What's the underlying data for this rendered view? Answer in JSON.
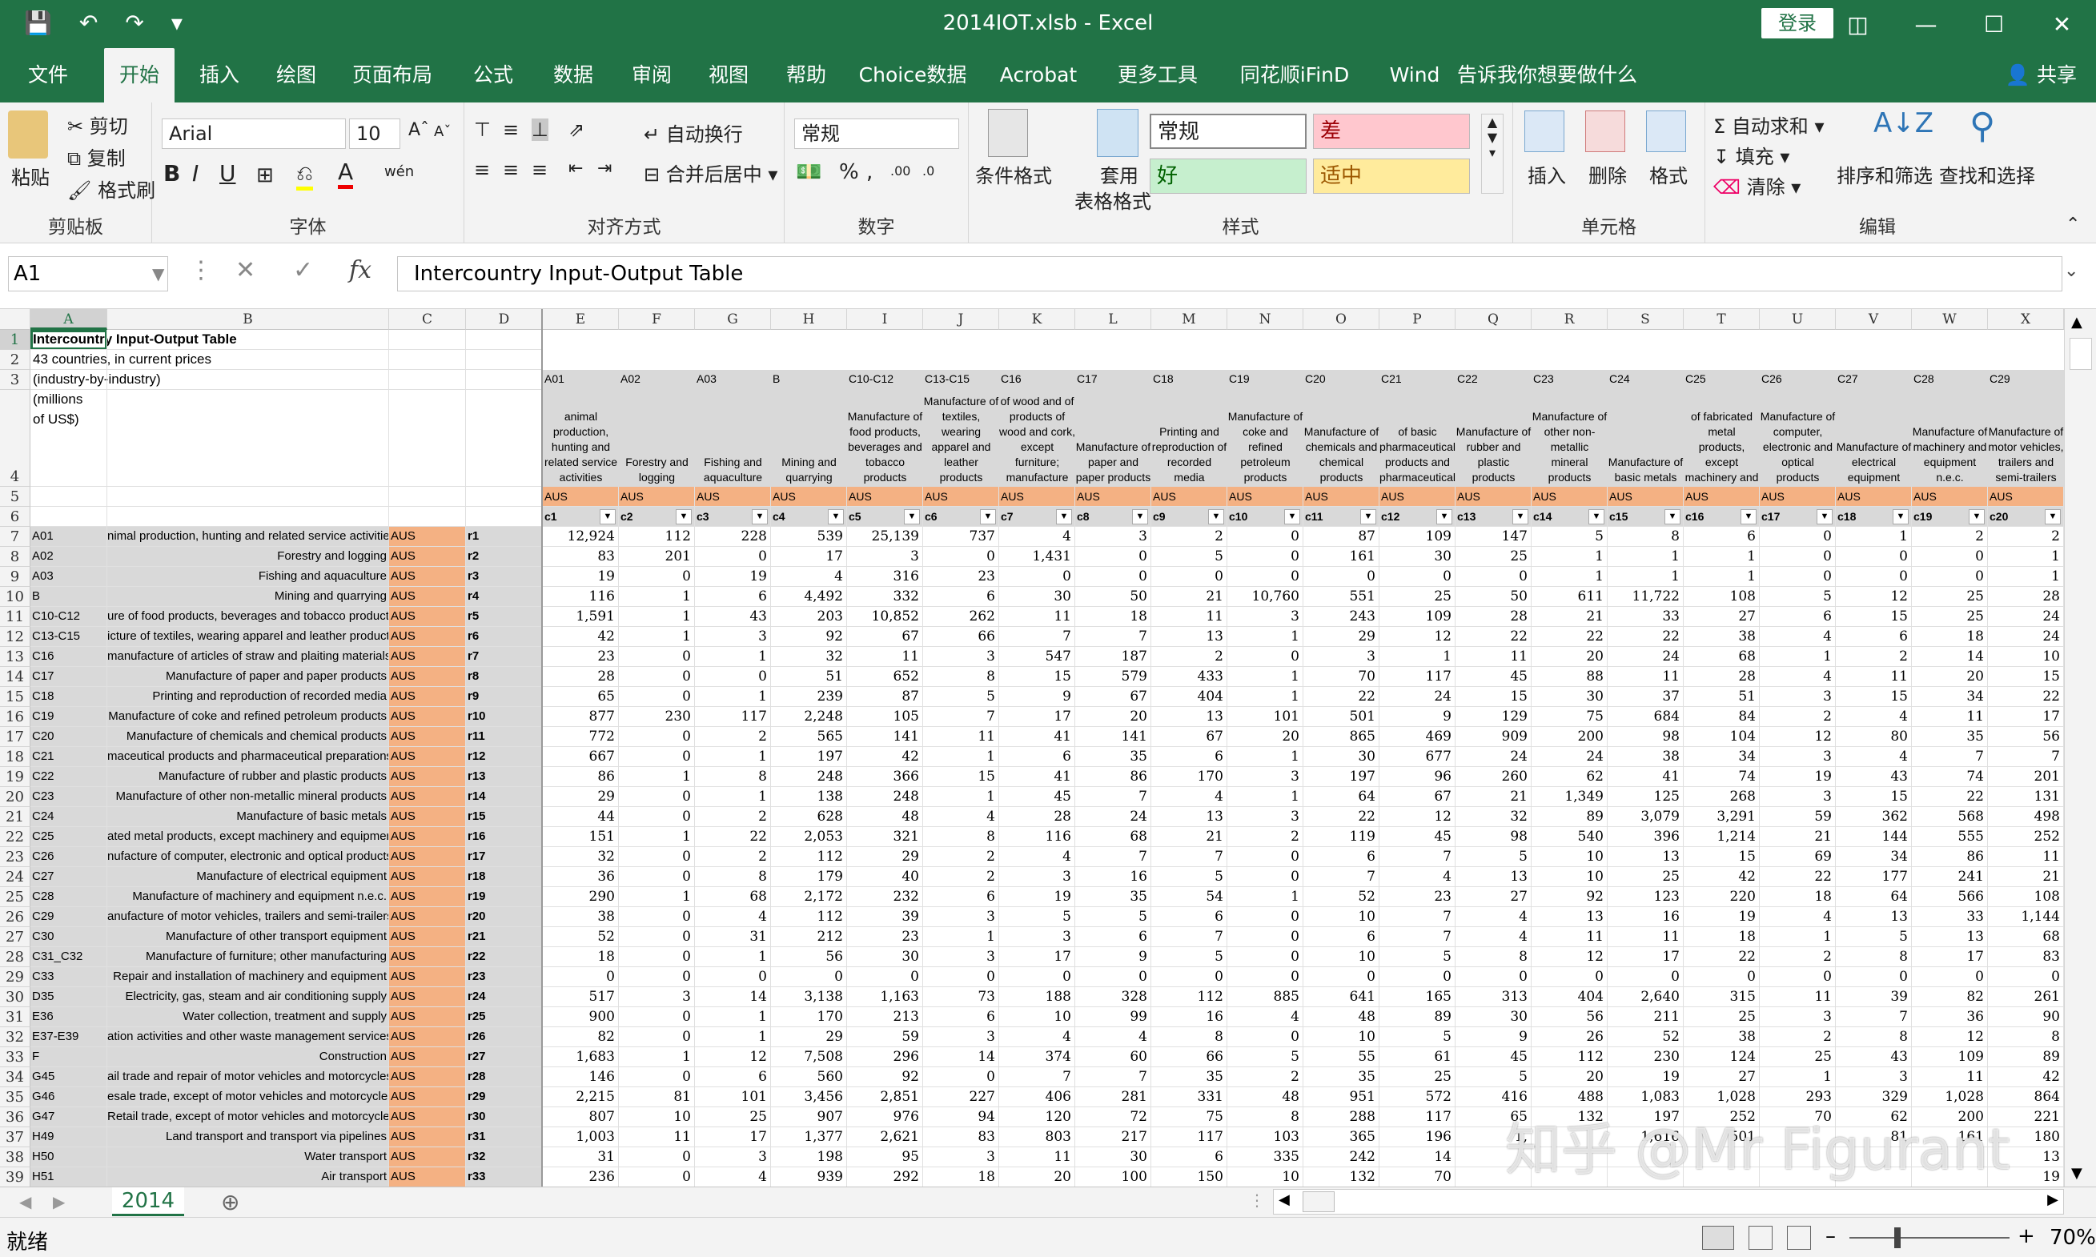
{
  "window": {
    "title": "2014IOT.xlsb  -  Excel",
    "login": "登录",
    "share": "共享"
  },
  "tabs": [
    "文件",
    "开始",
    "插入",
    "绘图",
    "页面布局",
    "公式",
    "数据",
    "审阅",
    "视图",
    "帮助",
    "Choice数据",
    "Acrobat",
    "更多工具",
    "同花顺iFinD",
    "Wind",
    "告诉我你想要做什么"
  ],
  "ribbon": {
    "clipboard": {
      "paste": "粘贴",
      "cut": "剪切",
      "copy": "复制",
      "format_painter": "格式刷",
      "label": "剪贴板"
    },
    "font": {
      "name": "Arial",
      "size": "10",
      "label": "字体"
    },
    "align": {
      "wrap": "自动换行",
      "merge": "合并后居中",
      "label": "对齐方式"
    },
    "number": {
      "format": "常规",
      "label": "数字"
    },
    "styles": {
      "cond": "条件格式",
      "table": "套用",
      "table2": "表格格式",
      "normal": "常规",
      "bad": "差",
      "good": "好",
      "neutral": "适中",
      "label": "样式"
    },
    "cells": {
      "insert": "插入",
      "delete": "删除",
      "format": "格式",
      "label": "单元格"
    },
    "edit": {
      "autosum": "自动求和",
      "fill": "填充",
      "clear": "清除",
      "sort": "排序和筛选",
      "find": "查找和选择",
      "label": "编辑"
    }
  },
  "formula_bar": {
    "name_box": "A1",
    "content": "Intercountry Input-Output Table"
  },
  "sheet": {
    "columns": [
      "A",
      "B",
      "C",
      "D",
      "E",
      "F",
      "G",
      "H",
      "I",
      "J",
      "K",
      "L",
      "M",
      "N",
      "O",
      "P",
      "Q",
      "R",
      "S",
      "T",
      "U",
      "V",
      "W",
      "X"
    ],
    "row_numbers": [
      "1",
      "2",
      "3",
      "4",
      "5",
      "6",
      "7",
      "8",
      "9",
      "10",
      "11",
      "12",
      "13",
      "14",
      "15",
      "16",
      "17",
      "18",
      "19",
      "20",
      "21",
      "22",
      "23",
      "24",
      "25",
      "26",
      "27",
      "28",
      "29",
      "30",
      "31",
      "32",
      "33",
      "34",
      "35",
      "36",
      "37",
      "38",
      "39"
    ],
    "title_lines": [
      "Intercountry Input-Output Table",
      "43 countries, in current prices",
      "(industry-by-industry)",
      "(millions",
      "of US$)"
    ],
    "col_codes": [
      "A01",
      "A02",
      "A03",
      "B",
      "C10-C12",
      "C13-C15",
      "C16",
      "C17",
      "C18",
      "C19",
      "C20",
      "C21",
      "C22",
      "C23",
      "C24",
      "C25",
      "C26",
      "C27",
      "C28",
      "C29"
    ],
    "col_names": [
      "animal production, hunting and related service activities",
      "Forestry and logging",
      "Fishing and aquaculture",
      "Mining and quarrying",
      "Manufacture of food products, beverages and tobacco products",
      "Manufacture of textiles, wearing apparel and leather products",
      "of wood and of products of wood and cork, except furniture; manufacture",
      "Manufacture of paper and paper products",
      "Printing and reproduction of recorded media",
      "Manufacture of coke and refined petroleum products",
      "Manufacture of chemicals and chemical products",
      "of basic pharmaceutical products and pharmaceutical",
      "Manufacture of rubber and plastic products",
      "Manufacture of other non-metallic mineral products",
      "Manufacture of basic metals",
      "of fabricated metal products, except machinery and",
      "Manufacture of computer, electronic and optical products",
      "Manufacture of electrical equipment",
      "Manufacture of machinery and equipment n.e.c.",
      "Manufacture of motor vehicles, trailers and semi-trailers"
    ],
    "col_country": "AUS",
    "col_ids": [
      "c1",
      "c2",
      "c3",
      "c4",
      "c5",
      "c6",
      "c7",
      "c8",
      "c9",
      "c10",
      "c11",
      "c12",
      "c13",
      "c14",
      "c15",
      "c16",
      "c17",
      "c18",
      "c19",
      "c20"
    ],
    "rows": [
      {
        "code": "A01",
        "name": "nimal production, hunting and related service activities",
        "id": "r1",
        "v": [
          "12,924",
          "112",
          "228",
          "539",
          "25,139",
          "737",
          "4",
          "3",
          "2",
          "0",
          "87",
          "109",
          "147",
          "5",
          "8",
          "6",
          "0",
          "1",
          "2",
          "2"
        ]
      },
      {
        "code": "A02",
        "name": "Forestry and logging",
        "id": "r2",
        "v": [
          "83",
          "201",
          "0",
          "17",
          "3",
          "0",
          "1,431",
          "0",
          "5",
          "0",
          "161",
          "30",
          "25",
          "1",
          "1",
          "1",
          "0",
          "0",
          "0",
          "1"
        ]
      },
      {
        "code": "A03",
        "name": "Fishing and aquaculture",
        "id": "r3",
        "v": [
          "19",
          "0",
          "19",
          "4",
          "316",
          "23",
          "0",
          "0",
          "0",
          "0",
          "0",
          "0",
          "0",
          "1",
          "1",
          "1",
          "0",
          "0",
          "0",
          "1"
        ]
      },
      {
        "code": "B",
        "name": "Mining and quarrying",
        "id": "r4",
        "v": [
          "116",
          "1",
          "6",
          "4,492",
          "332",
          "6",
          "30",
          "50",
          "21",
          "10,760",
          "551",
          "25",
          "50",
          "611",
          "11,722",
          "108",
          "5",
          "12",
          "25",
          "28"
        ]
      },
      {
        "code": "C10-C12",
        "name": "ure of food products, beverages and tobacco products",
        "id": "r5",
        "v": [
          "1,591",
          "1",
          "43",
          "203",
          "10,852",
          "262",
          "11",
          "18",
          "11",
          "3",
          "243",
          "109",
          "28",
          "21",
          "33",
          "27",
          "6",
          "15",
          "25",
          "24"
        ]
      },
      {
        "code": "C13-C15",
        "name": "icture of textiles, wearing apparel and leather products",
        "id": "r6",
        "v": [
          "42",
          "1",
          "3",
          "92",
          "67",
          "66",
          "7",
          "7",
          "13",
          "1",
          "29",
          "12",
          "22",
          "22",
          "22",
          "38",
          "4",
          "6",
          "18",
          "24"
        ]
      },
      {
        "code": "C16",
        "name": "manufacture of articles of straw and plaiting materials",
        "id": "r7",
        "v": [
          "23",
          "0",
          "1",
          "32",
          "11",
          "3",
          "547",
          "187",
          "2",
          "0",
          "3",
          "1",
          "11",
          "20",
          "24",
          "68",
          "1",
          "2",
          "14",
          "10"
        ]
      },
      {
        "code": "C17",
        "name": "Manufacture of paper and paper products",
        "id": "r8",
        "v": [
          "28",
          "0",
          "0",
          "51",
          "652",
          "8",
          "15",
          "579",
          "433",
          "1",
          "70",
          "117",
          "45",
          "88",
          "11",
          "28",
          "4",
          "11",
          "20",
          "15"
        ]
      },
      {
        "code": "C18",
        "name": "Printing and reproduction of recorded media",
        "id": "r9",
        "v": [
          "65",
          "0",
          "1",
          "239",
          "87",
          "5",
          "9",
          "67",
          "404",
          "1",
          "22",
          "24",
          "15",
          "30",
          "37",
          "51",
          "3",
          "15",
          "34",
          "22"
        ]
      },
      {
        "code": "C19",
        "name": "Manufacture of coke and refined petroleum products",
        "id": "r10",
        "v": [
          "877",
          "230",
          "117",
          "2,248",
          "105",
          "7",
          "17",
          "20",
          "13",
          "101",
          "501",
          "9",
          "129",
          "75",
          "684",
          "84",
          "2",
          "4",
          "11",
          "17"
        ]
      },
      {
        "code": "C20",
        "name": "Manufacture of chemicals and chemical products",
        "id": "r11",
        "v": [
          "772",
          "0",
          "2",
          "565",
          "141",
          "11",
          "41",
          "141",
          "67",
          "20",
          "865",
          "469",
          "909",
          "200",
          "98",
          "104",
          "12",
          "80",
          "35",
          "56"
        ]
      },
      {
        "code": "C21",
        "name": "maceutical products and pharmaceutical preparations",
        "id": "r12",
        "v": [
          "667",
          "0",
          "1",
          "197",
          "42",
          "1",
          "6",
          "35",
          "6",
          "1",
          "30",
          "677",
          "24",
          "24",
          "38",
          "34",
          "3",
          "4",
          "7",
          "7"
        ]
      },
      {
        "code": "C22",
        "name": "Manufacture of rubber and plastic products",
        "id": "r13",
        "v": [
          "86",
          "1",
          "8",
          "248",
          "366",
          "15",
          "41",
          "86",
          "170",
          "3",
          "197",
          "96",
          "260",
          "62",
          "41",
          "74",
          "19",
          "43",
          "74",
          "201"
        ]
      },
      {
        "code": "C23",
        "name": "Manufacture of other non-metallic mineral products",
        "id": "r14",
        "v": [
          "29",
          "0",
          "1",
          "138",
          "248",
          "1",
          "45",
          "7",
          "4",
          "1",
          "64",
          "67",
          "21",
          "1,349",
          "125",
          "268",
          "3",
          "15",
          "22",
          "131"
        ]
      },
      {
        "code": "C24",
        "name": "Manufacture of basic metals",
        "id": "r15",
        "v": [
          "44",
          "0",
          "2",
          "628",
          "48",
          "4",
          "28",
          "24",
          "13",
          "3",
          "22",
          "12",
          "32",
          "89",
          "3,079",
          "3,291",
          "59",
          "362",
          "568",
          "498"
        ]
      },
      {
        "code": "C25",
        "name": "ated metal products, except machinery and equipment",
        "id": "r16",
        "v": [
          "151",
          "1",
          "22",
          "2,053",
          "321",
          "8",
          "116",
          "68",
          "21",
          "2",
          "119",
          "45",
          "98",
          "540",
          "396",
          "1,214",
          "21",
          "144",
          "555",
          "252"
        ]
      },
      {
        "code": "C26",
        "name": "nufacture of computer, electronic and optical products",
        "id": "r17",
        "v": [
          "32",
          "0",
          "2",
          "112",
          "29",
          "2",
          "4",
          "7",
          "7",
          "0",
          "6",
          "7",
          "5",
          "10",
          "13",
          "15",
          "69",
          "34",
          "86",
          "11"
        ]
      },
      {
        "code": "C27",
        "name": "Manufacture of electrical equipment",
        "id": "r18",
        "v": [
          "36",
          "0",
          "8",
          "179",
          "40",
          "2",
          "3",
          "16",
          "5",
          "0",
          "7",
          "4",
          "13",
          "10",
          "25",
          "42",
          "22",
          "177",
          "241",
          "21"
        ]
      },
      {
        "code": "C28",
        "name": "Manufacture of machinery and equipment n.e.c.",
        "id": "r19",
        "v": [
          "290",
          "1",
          "68",
          "2,172",
          "232",
          "6",
          "19",
          "35",
          "54",
          "1",
          "52",
          "23",
          "27",
          "92",
          "123",
          "220",
          "18",
          "64",
          "566",
          "108"
        ]
      },
      {
        "code": "C29",
        "name": "anufacture of motor vehicles, trailers and semi-trailers",
        "id": "r20",
        "v": [
          "38",
          "0",
          "4",
          "112",
          "39",
          "3",
          "5",
          "5",
          "6",
          "0",
          "10",
          "7",
          "4",
          "13",
          "16",
          "19",
          "4",
          "13",
          "33",
          "1,144"
        ]
      },
      {
        "code": "C30",
        "name": "Manufacture of other transport equipment",
        "id": "r21",
        "v": [
          "52",
          "0",
          "31",
          "212",
          "23",
          "1",
          "3",
          "6",
          "7",
          "0",
          "6",
          "7",
          "4",
          "11",
          "11",
          "18",
          "1",
          "5",
          "13",
          "68"
        ]
      },
      {
        "code": "C31_C32",
        "name": "Manufacture of furniture; other manufacturing",
        "id": "r22",
        "v": [
          "18",
          "0",
          "1",
          "56",
          "30",
          "3",
          "17",
          "9",
          "5",
          "0",
          "10",
          "5",
          "8",
          "12",
          "17",
          "22",
          "2",
          "8",
          "17",
          "83"
        ]
      },
      {
        "code": "C33",
        "name": "Repair and installation of machinery and equipment",
        "id": "r23",
        "v": [
          "0",
          "0",
          "0",
          "0",
          "0",
          "0",
          "0",
          "0",
          "0",
          "0",
          "0",
          "0",
          "0",
          "0",
          "0",
          "0",
          "0",
          "0",
          "0",
          "0"
        ]
      },
      {
        "code": "D35",
        "name": "Electricity, gas, steam and air conditioning supply",
        "id": "r24",
        "v": [
          "517",
          "3",
          "14",
          "3,138",
          "1,163",
          "73",
          "188",
          "328",
          "112",
          "885",
          "641",
          "165",
          "313",
          "404",
          "2,640",
          "315",
          "11",
          "39",
          "82",
          "261"
        ]
      },
      {
        "code": "E36",
        "name": "Water collection, treatment and supply",
        "id": "r25",
        "v": [
          "900",
          "0",
          "1",
          "170",
          "213",
          "6",
          "10",
          "99",
          "16",
          "4",
          "48",
          "89",
          "30",
          "56",
          "211",
          "25",
          "3",
          "7",
          "36",
          "90"
        ]
      },
      {
        "code": "E37-E39",
        "name": "ation activities and other waste management services",
        "id": "r26",
        "v": [
          "82",
          "0",
          "1",
          "29",
          "59",
          "3",
          "4",
          "4",
          "8",
          "0",
          "10",
          "5",
          "9",
          "26",
          "52",
          "38",
          "2",
          "8",
          "12",
          "8"
        ]
      },
      {
        "code": "F",
        "name": "Construction",
        "id": "r27",
        "v": [
          "1,683",
          "1",
          "12",
          "7,508",
          "296",
          "14",
          "374",
          "60",
          "66",
          "5",
          "55",
          "61",
          "45",
          "112",
          "230",
          "124",
          "25",
          "43",
          "109",
          "89"
        ]
      },
      {
        "code": "G45",
        "name": "ail trade and repair of motor vehicles and motorcycles",
        "id": "r28",
        "v": [
          "146",
          "0",
          "6",
          "560",
          "92",
          "0",
          "7",
          "7",
          "35",
          "2",
          "35",
          "25",
          "5",
          "20",
          "19",
          "27",
          "1",
          "3",
          "11",
          "42"
        ]
      },
      {
        "code": "G46",
        "name": "esale trade, except of motor vehicles and motorcycles",
        "id": "r29",
        "v": [
          "2,215",
          "81",
          "101",
          "3,456",
          "2,851",
          "227",
          "406",
          "281",
          "331",
          "48",
          "951",
          "572",
          "416",
          "488",
          "1,083",
          "1,028",
          "293",
          "329",
          "1,028",
          "864"
        ]
      },
      {
        "code": "G47",
        "name": "Retail trade, except of motor vehicles and motorcycles",
        "id": "r30",
        "v": [
          "807",
          "10",
          "25",
          "907",
          "976",
          "94",
          "120",
          "72",
          "75",
          "8",
          "288",
          "117",
          "65",
          "132",
          "197",
          "252",
          "70",
          "62",
          "200",
          "221"
        ]
      },
      {
        "code": "H49",
        "name": "Land transport and transport via pipelines",
        "id": "r31",
        "v": [
          "1,003",
          "11",
          "17",
          "1,377",
          "2,621",
          "83",
          "803",
          "217",
          "117",
          "103",
          "365",
          "196",
          "1,",
          "",
          "1,616",
          "501",
          "",
          "81",
          "161",
          "180"
        ]
      },
      {
        "code": "H50",
        "name": "Water transport",
        "id": "r32",
        "v": [
          "31",
          "0",
          "3",
          "198",
          "95",
          "3",
          "11",
          "30",
          "6",
          "335",
          "242",
          "14",
          "",
          "",
          "",
          "",
          "",
          "",
          "",
          "13"
        ]
      },
      {
        "code": "H51",
        "name": "Air transport",
        "id": "r33",
        "v": [
          "236",
          "0",
          "4",
          "939",
          "292",
          "18",
          "20",
          "100",
          "150",
          "10",
          "132",
          "70",
          "",
          "",
          "",
          "",
          "",
          "",
          "",
          "19"
        ]
      }
    ]
  },
  "sheet_tab": "2014",
  "status": {
    "ready": "就绪",
    "zoom": "70%"
  },
  "watermark": "知乎 @Mr Figurant"
}
